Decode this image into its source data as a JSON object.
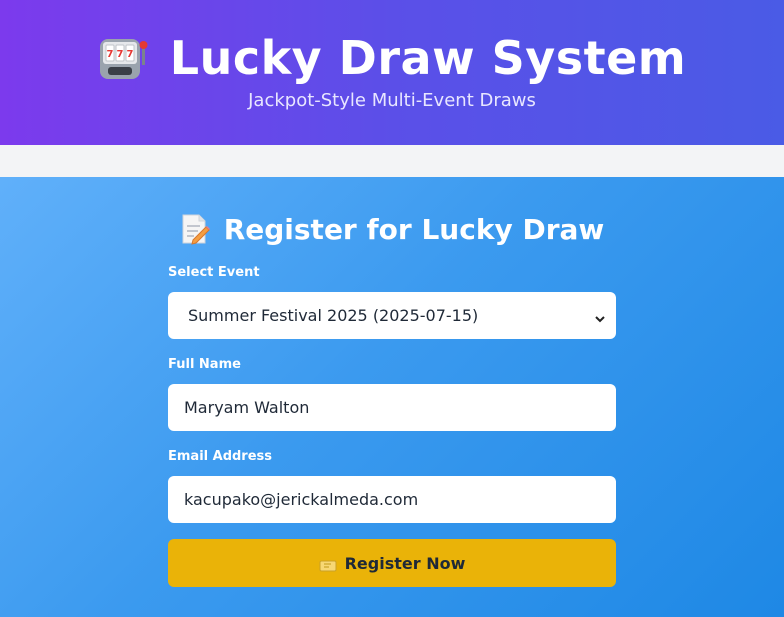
{
  "header": {
    "title": "Lucky Draw System",
    "subtitle": "Jackpot-Style Multi-Event Draws",
    "icon": "slot-machine-icon"
  },
  "register": {
    "title": "Register for Lucky Draw",
    "icon": "memo-icon",
    "event_label": "Select Event",
    "event_value": "Summer Festival 2025 (2025-07-15)",
    "name_label": "Full Name",
    "name_value": "Maryam Walton",
    "email_label": "Email Address",
    "email_value": "kacupako@jerickalmeda.com",
    "button_label": "Register Now",
    "button_icon": "ticket-icon"
  },
  "colors": {
    "header_start": "#7c3aed",
    "header_end": "#4a5be6",
    "panel_start": "#60b0fa",
    "panel_end": "#1e88e5",
    "button": "#eab308"
  }
}
